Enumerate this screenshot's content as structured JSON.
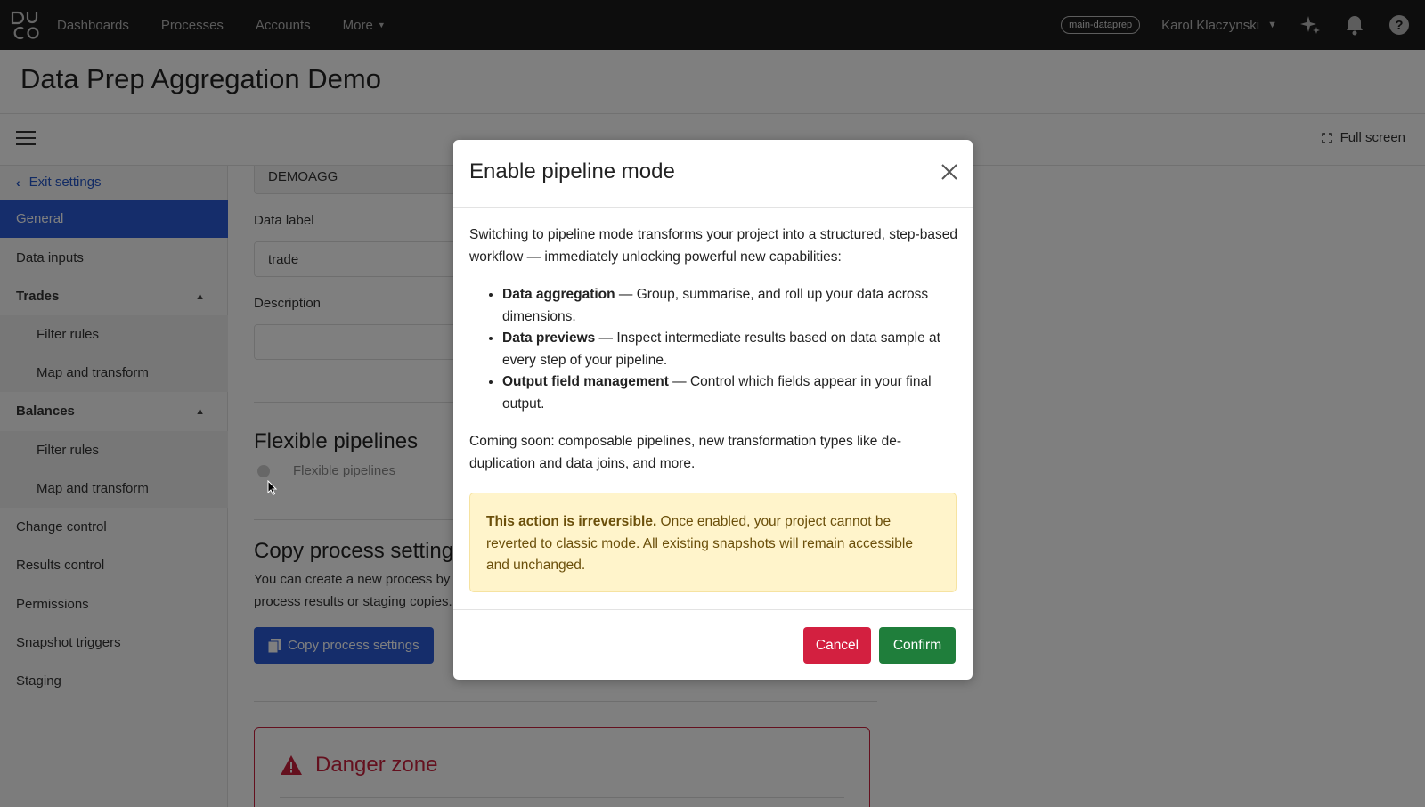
{
  "nav": {
    "links": [
      "Dashboards",
      "Processes",
      "Accounts",
      "More"
    ],
    "env_badge": "main-dataprep",
    "user": "Karol Klaczynski",
    "icons": [
      "sparkle-icon",
      "bell-icon",
      "help-icon"
    ]
  },
  "page": {
    "title": "Data Prep Aggregation Demo"
  },
  "toolbar": {
    "fullscreen_label": "Full screen"
  },
  "sidebar": {
    "exit_label": "Exit settings",
    "items": {
      "general": "General",
      "data_inputs": "Data inputs",
      "trades": "Trades",
      "trades_filter": "Filter rules",
      "trades_map": "Map and transform",
      "balances": "Balances",
      "balances_filter": "Filter rules",
      "balances_map": "Map and transform",
      "change_control": "Change control",
      "results_control": "Results control",
      "permissions": "Permissions",
      "snapshot_triggers": "Snapshot triggers",
      "staging": "Staging"
    }
  },
  "main": {
    "code_value": "DEMOAGG",
    "data_label_label": "Data label",
    "data_label_value": "trade",
    "description_label": "Description",
    "description_value": "",
    "flexible_title": "Flexible pipelines",
    "flexible_toggle_label": "Flexible pipelines",
    "copy_title": "Copy process settings",
    "copy_text_line1": "You can create a new process by c",
    "copy_text_line2": "process results or staging copies.",
    "copy_button": "Copy process settings",
    "danger_title": "Danger zone"
  },
  "modal": {
    "title": "Enable pipeline mode",
    "intro": "Switching to pipeline mode transforms your project into a structured, step-based workflow — immediately unlocking powerful new capabilities:",
    "features": [
      {
        "name": "Data aggregation",
        "text": " — Group, summarise, and roll up your data across dimensions."
      },
      {
        "name": "Data previews",
        "text": " — Inspect intermediate results based on data sample at every step of your pipeline."
      },
      {
        "name": "Output field management",
        "text": " — Control which fields appear in your final output."
      }
    ],
    "coming_soon": "Coming soon: composable pipelines, new transformation types like de-duplication and data joins, and more.",
    "warning_bold": "This action is irreversible.",
    "warning_text": " Once enabled, your project cannot be reverted to classic mode. All existing snapshots will remain accessible and unchanged.",
    "cancel_label": "Cancel",
    "confirm_label": "Confirm"
  },
  "colors": {
    "accent_blue": "#2a5bd7",
    "danger_red": "#d32040",
    "confirm_green": "#1f7e3b",
    "warning_bg": "#fff4cb"
  }
}
